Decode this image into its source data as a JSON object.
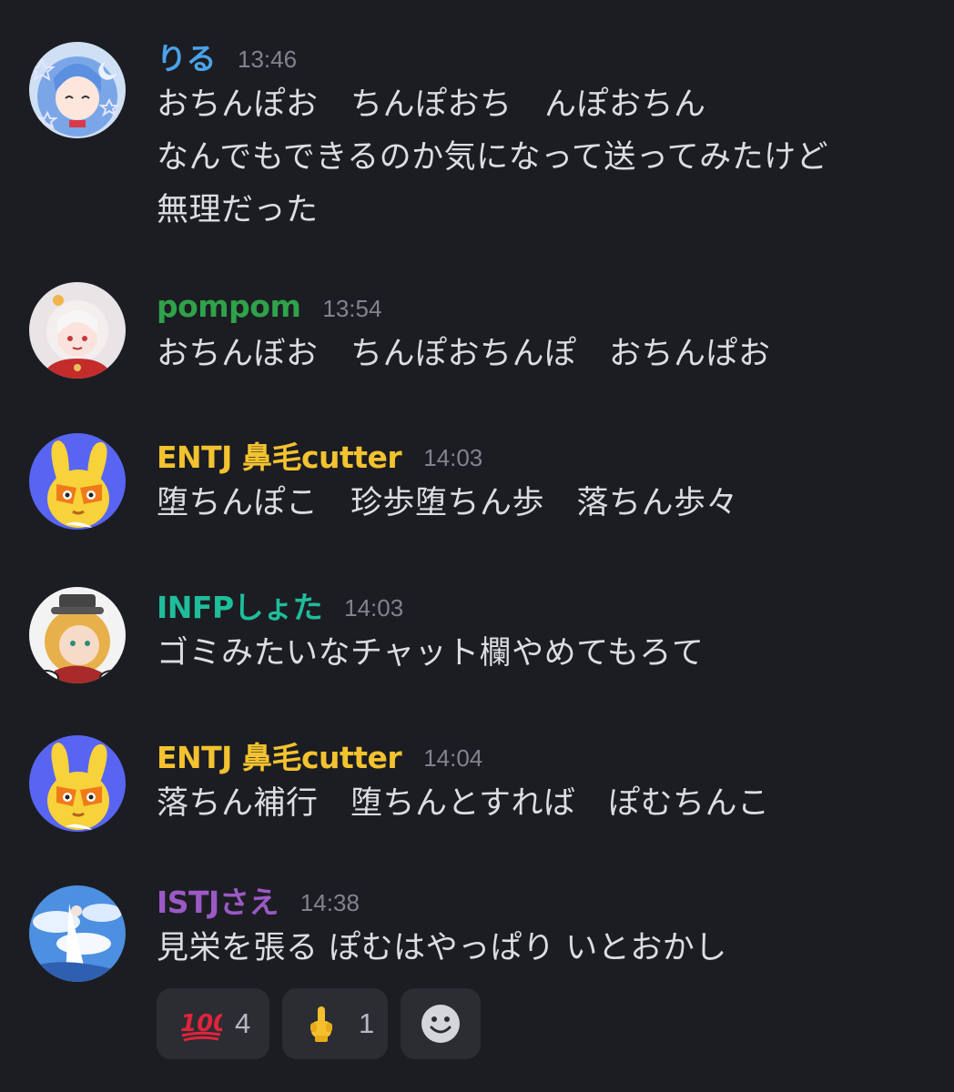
{
  "colors": {
    "background": "#1c1d22",
    "message_text": "#dcdde1",
    "timestamp": "#80848e",
    "reaction_bg": "#2b2d33"
  },
  "messages": [
    {
      "username": "りる",
      "username_color": "#4aa3ea",
      "timestamp": "13:46",
      "avatar_icon": "anime-girl-blue-hair-icon",
      "lines": [
        "おちんぽお　ちんぽおち　んぽおちん",
        "なんでもできるのか気になって送ってみたけど",
        "無理だった"
      ]
    },
    {
      "username": "pompom",
      "username_color": "#2fa24a",
      "timestamp": "13:54",
      "avatar_icon": "anime-girl-white-hair-icon",
      "lines": [
        "おちんぼお　ちんぽおちんぽ　おちんぱお"
      ]
    },
    {
      "username": "ENTJ 鼻毛cutter",
      "username_color": "#f2c230",
      "timestamp": "14:03",
      "avatar_icon": "yellow-bunny-icon",
      "lines": [
        "堕ちんぽこ　珍歩堕ちん歩　落ちん歩々"
      ]
    },
    {
      "username": "INFPしょた",
      "username_color": "#1fbd9c",
      "timestamp": "14:03",
      "avatar_icon": "blonde-character-hat-icon",
      "lines": [
        "ゴミみたいなチャット欄やめてもろて"
      ]
    },
    {
      "username": "ENTJ 鼻毛cutter",
      "username_color": "#f2c230",
      "timestamp": "14:04",
      "avatar_icon": "yellow-bunny-icon",
      "lines": [
        "落ちん補行　堕ちんとすれば　ぽむちんこ"
      ]
    },
    {
      "username": "ISTJさえ",
      "username_color": "#9b59c6",
      "timestamp": "14:38",
      "avatar_icon": "sky-landscape-icon",
      "lines": [
        "見栄を張る ぽむはやっぱり いとおかし"
      ]
    }
  ],
  "reactions": [
    {
      "emoji": "hundred-points-icon",
      "count": "4"
    },
    {
      "emoji": "middle-finger-icon",
      "count": "1"
    },
    {
      "emoji": "add-reaction-icon"
    }
  ]
}
